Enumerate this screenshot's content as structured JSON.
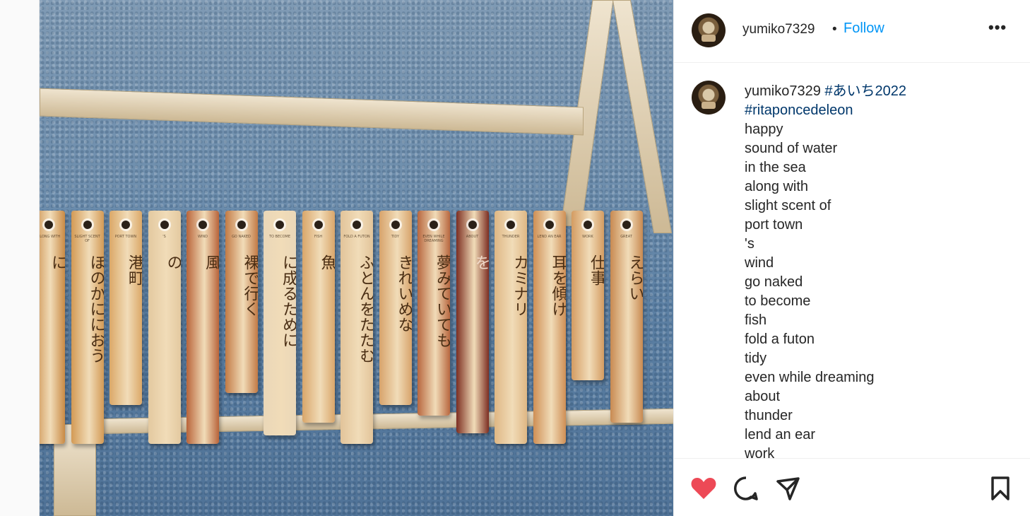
{
  "post": {
    "username": "yumiko7329",
    "separator": "•",
    "follow_label": "Follow",
    "more_label": "•••"
  },
  "caption": {
    "username": "yumiko7329",
    "hashtag_1": "#あいち2022",
    "hashtag_2": "#ritaponcedeleon",
    "lines": [
      "happy",
      "sound of water",
      "in the sea",
      "along with",
      "slight scent of",
      "port town",
      "'s",
      "wind",
      "go naked",
      "to become",
      "fish",
      "fold a futon",
      "tidy",
      "even while dreaming",
      "about",
      "thunder",
      "lend an ear",
      "work"
    ]
  },
  "image": {
    "bars": [
      {
        "jp": "に",
        "small": "ALONG WITH"
      },
      {
        "jp": "ほのかににおう",
        "small": "SLIGHT SCENT OF"
      },
      {
        "jp": "港町",
        "small": "PORT TOWN"
      },
      {
        "jp": "の",
        "small": "'S"
      },
      {
        "jp": "風",
        "small": "WIND"
      },
      {
        "jp": "裸で行く",
        "small": "GO NAKED"
      },
      {
        "jp": "に成るために",
        "small": "TO BECOME"
      },
      {
        "jp": "魚",
        "small": "FISH"
      },
      {
        "jp": "ふとんをたたむ",
        "small": "FOLD A FUTON"
      },
      {
        "jp": "きれいめな",
        "small": "TIDY"
      },
      {
        "jp": "夢みていても",
        "small": "EVEN WHILE DREAMING"
      },
      {
        "jp": "を",
        "small": "ABOUT"
      },
      {
        "jp": "カミナリ",
        "small": "THUNDER"
      },
      {
        "jp": "耳を傾け",
        "small": "LEND AN EAR"
      },
      {
        "jp": "仕事",
        "small": "WORK"
      },
      {
        "jp": "えらい",
        "small": "GREAT"
      }
    ]
  },
  "actions": {
    "like_icon": "heart-icon",
    "comment_icon": "comment-icon",
    "share_icon": "share-icon",
    "save_icon": "bookmark-icon",
    "like_color": "#ed4956"
  }
}
